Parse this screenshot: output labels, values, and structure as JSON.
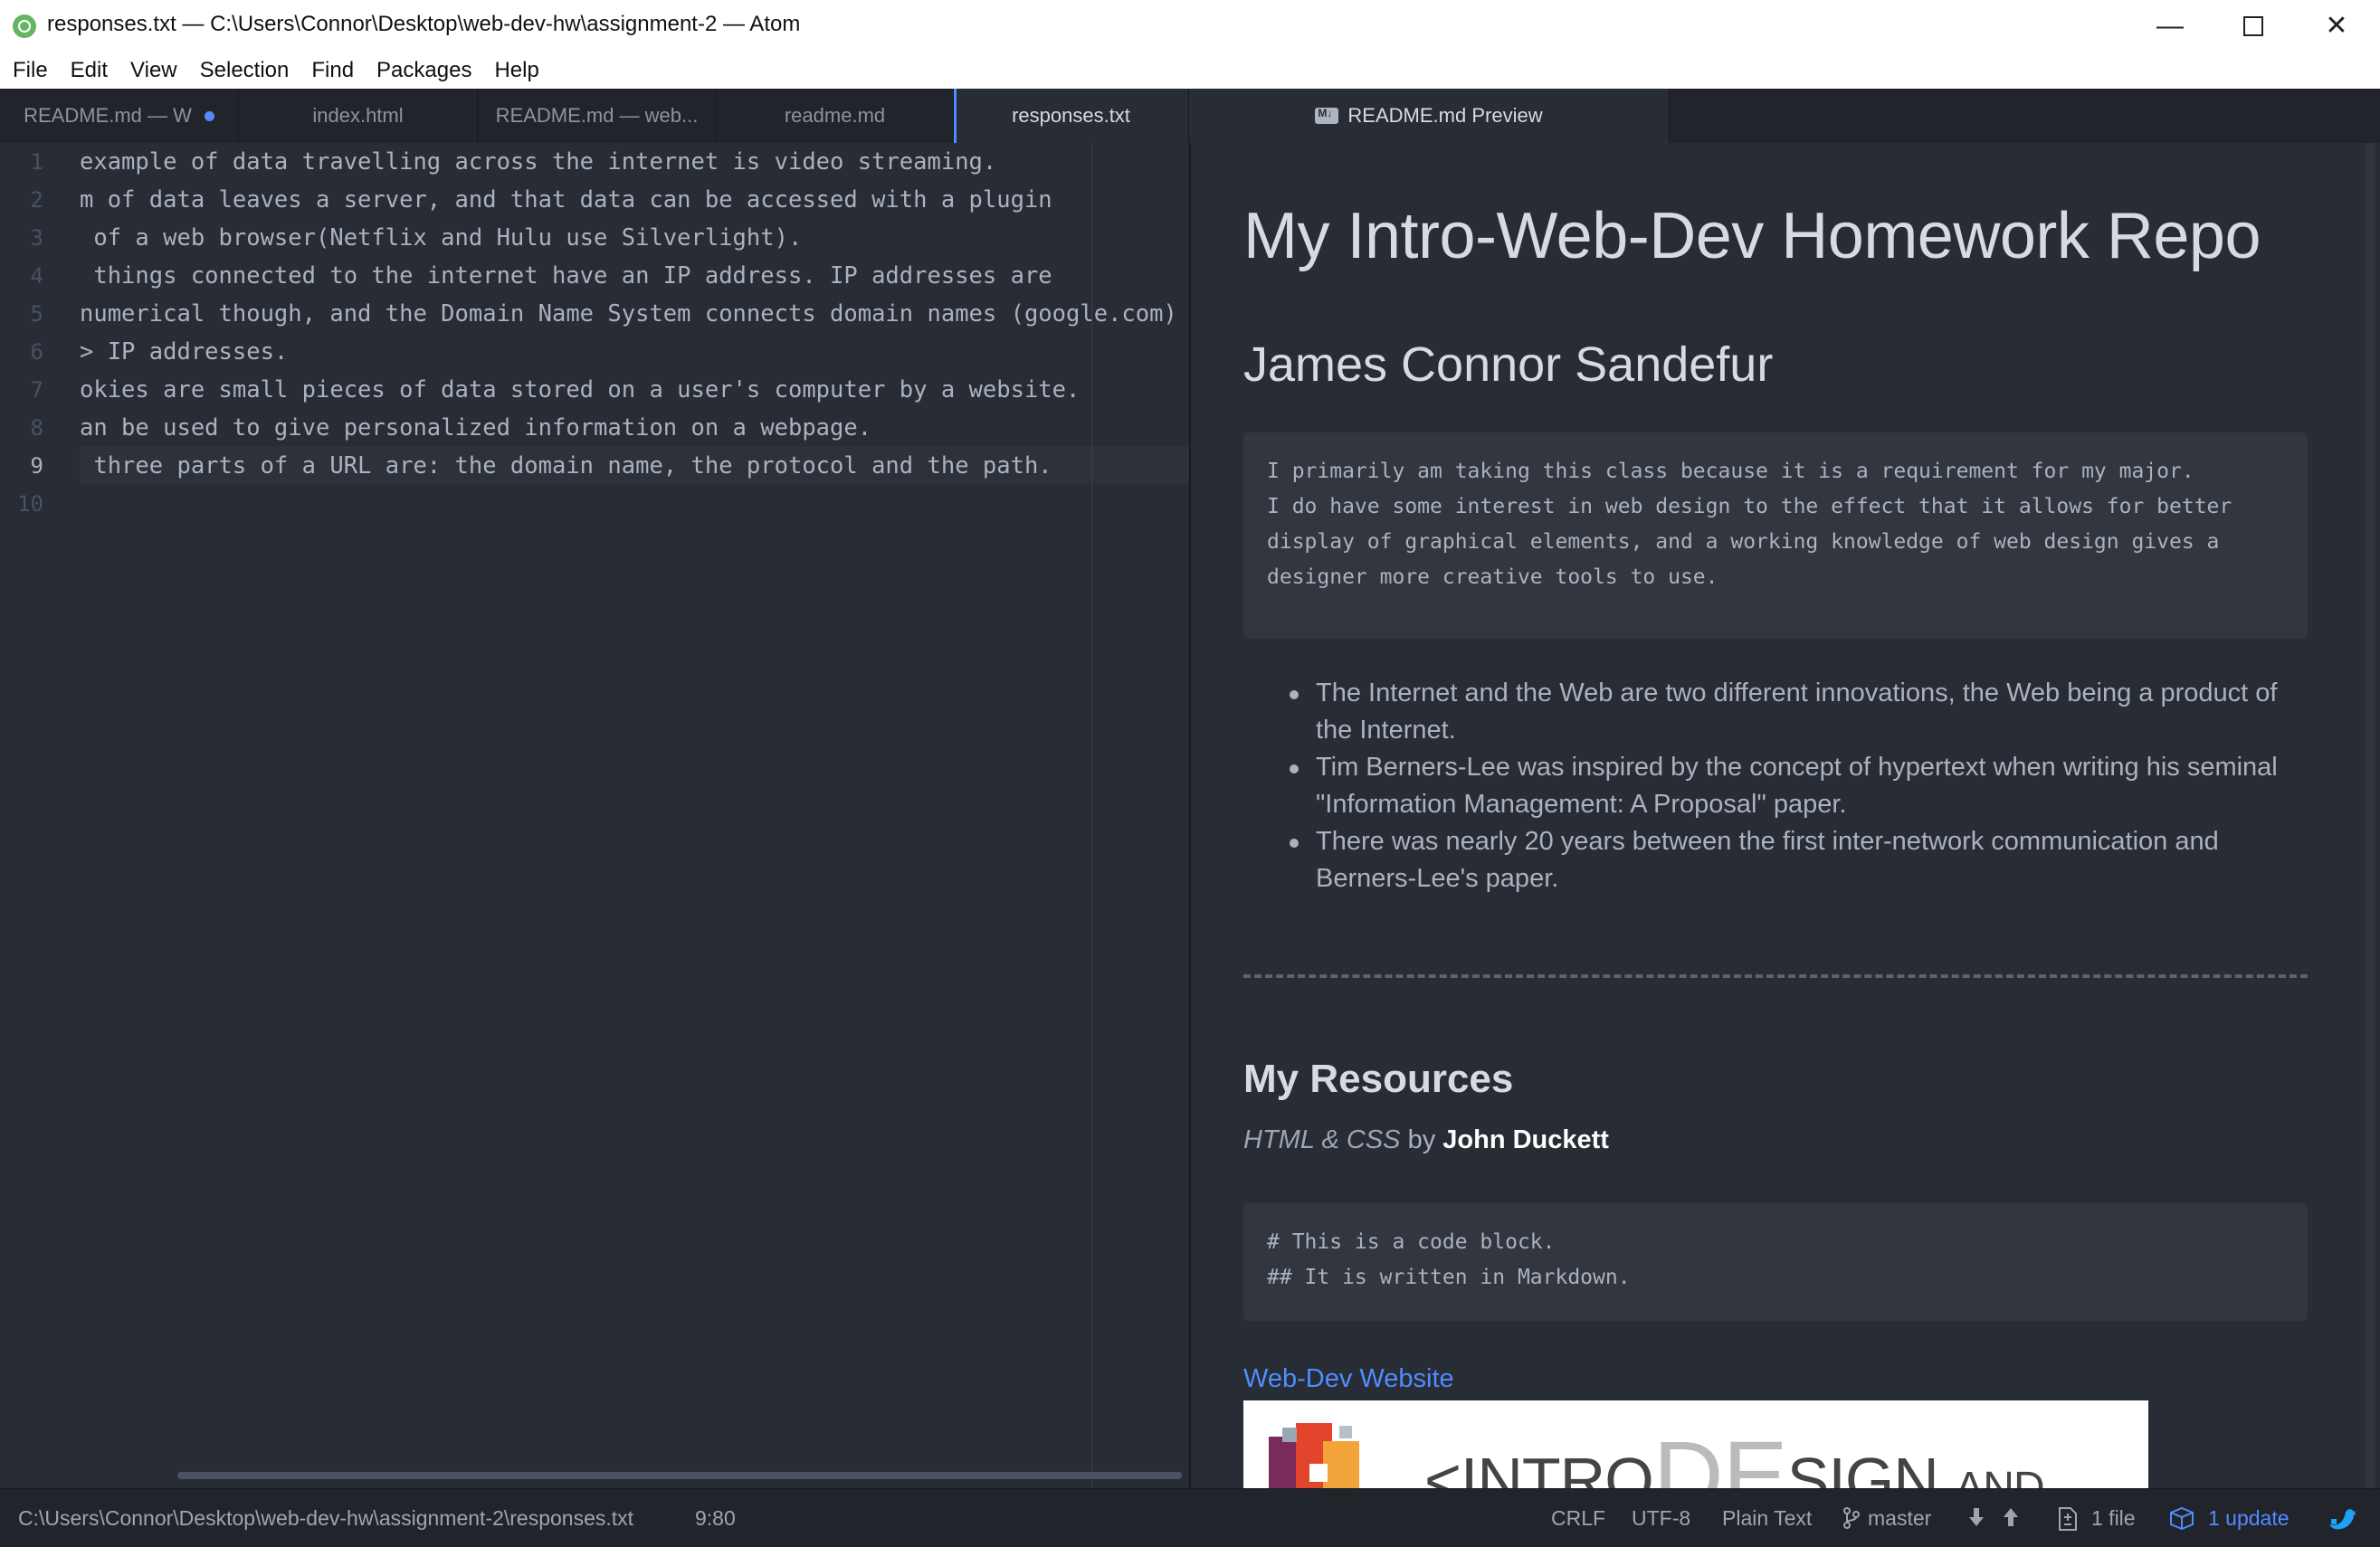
{
  "chrome": {
    "title": "responses.txt — C:\\Users\\Connor\\Desktop\\web-dev-hw\\assignment-2 — Atom"
  },
  "menu": [
    {
      "key": "file",
      "label": "File"
    },
    {
      "key": "edit",
      "label": "Edit"
    },
    {
      "key": "view",
      "label": "View"
    },
    {
      "key": "selection",
      "label": "Selection"
    },
    {
      "key": "find",
      "label": "Find"
    },
    {
      "key": "packages",
      "label": "Packages"
    },
    {
      "key": "help",
      "label": "Help"
    }
  ],
  "tabs": [
    {
      "label": "README.md — W",
      "modified": true,
      "active": false
    },
    {
      "label": "index.html",
      "modified": false,
      "active": false
    },
    {
      "label": "README.md — web...",
      "modified": false,
      "active": false
    },
    {
      "label": "readme.md",
      "modified": false,
      "active": false
    },
    {
      "label": "responses.txt",
      "modified": false,
      "active": true
    }
  ],
  "preview_tab": {
    "icon": "md-file-icon",
    "label": "README.md Preview"
  },
  "editor": {
    "lines": [
      {
        "n": "1",
        "t": "example of data travelling across the internet is video streaming."
      },
      {
        "n": "2",
        "t": "m of data leaves a server, and that data can be accessed with a plugin"
      },
      {
        "n": "3",
        "t": " of a web browser(Netflix and Hulu use Silverlight)."
      },
      {
        "n": "4",
        "t": " things connected to the internet have an IP address. IP addresses are"
      },
      {
        "n": "5",
        "t": "numerical though, and the Domain Name System connects domain names (google.com)"
      },
      {
        "n": "6",
        "t": "> IP addresses."
      },
      {
        "n": "7",
        "t": "okies are small pieces of data stored on a user's computer by a website."
      },
      {
        "n": "8",
        "t": "an be used to give personalized information on a webpage."
      },
      {
        "n": "9",
        "t": " three parts of a URL are: the domain name, the protocol and the path."
      },
      {
        "n": "10",
        "t": ""
      }
    ],
    "current_line": "9"
  },
  "preview": {
    "h1": "My Intro-Web-Dev Homework Repo",
    "h2": "James Connor Sandefur",
    "pre1": [
      "I primarily am taking this class because it is a requirement for my major.",
      "I do have some interest in web design to the effect that it allows for better",
      "display of graphical elements, and a working knowledge of web design gives a",
      "designer more creative tools to use."
    ],
    "bullets": [
      "The Internet and the Web are two different innovations, the Web being a product of the Internet.",
      "Tim Berners-Lee was inspired by the concept of hypertext when writing his seminal \"Information Management: A Proposal\" paper.",
      "There was nearly 20 years between the first inter-network communication and Berners-Lee's paper."
    ],
    "h2b": "My Resources",
    "book": {
      "title": "HTML & CSS",
      "by": "by",
      "author": "John Duckett"
    },
    "pre2": [
      "# This is a code block.",
      "## It is written in Markdown."
    ],
    "link": "Web-Dev Website",
    "banner": {
      "lt": "<",
      "intro": "INTRO",
      "de": "DE",
      "sign": "SIGN",
      "and": "AND"
    }
  },
  "status": {
    "path": "C:\\Users\\Connor\\Desktop\\web-dev-hw\\assignment-2\\responses.txt",
    "cursor": "9:80",
    "eol": "CRLF",
    "encoding": "UTF-8",
    "grammar": "Plain Text",
    "branch": "master",
    "files": "1 file",
    "updates": "1 update"
  },
  "colors": {
    "accent": "#528bff",
    "link": "#4e8dff",
    "editor_bg": "#282c34",
    "panel_bg": "#21252b"
  }
}
